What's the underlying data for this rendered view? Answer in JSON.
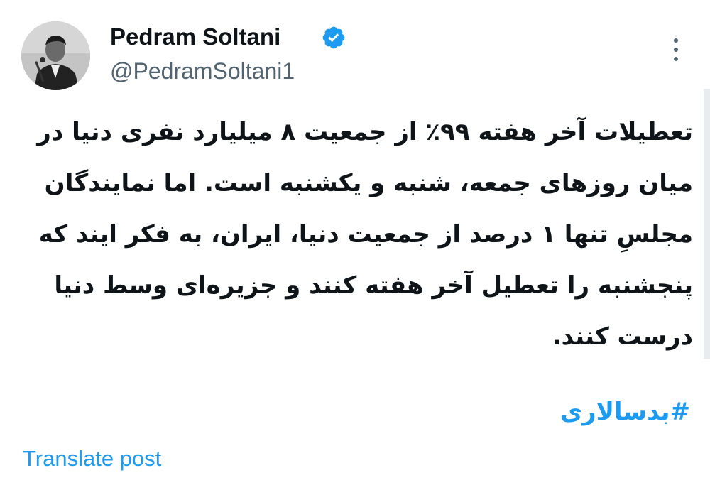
{
  "author": {
    "display_name": "Pedram Soltani",
    "handle": "@PedramSoltani1",
    "verified": true,
    "avatar_icon": "profile-photo-man-at-microphone"
  },
  "post": {
    "text": "تعطیلات آخر هفته ۹۹٪ از جمعیت ۸ میلیارد نفری دنیا در\nمیان روزهای جمعه، شنبه و یکشنبه است. اما نمایندگان\nمجلسِ تنها ۱ درصد از جمعیت دنیا، ایران، به فکر ایند که\nپنجشنبه را تعطیل آخر هفته کنند و جزیره‌ای وسط دنیا\nدرست کنند.",
    "hashtag": "#بدسالاری"
  },
  "actions": {
    "translate_label": "Translate post",
    "more_icon": "vertical-ellipsis-icon"
  },
  "colors": {
    "link": "#1d9bf0",
    "secondary_text": "#536471",
    "primary_text": "#0f1419",
    "background": "#ffffff"
  }
}
